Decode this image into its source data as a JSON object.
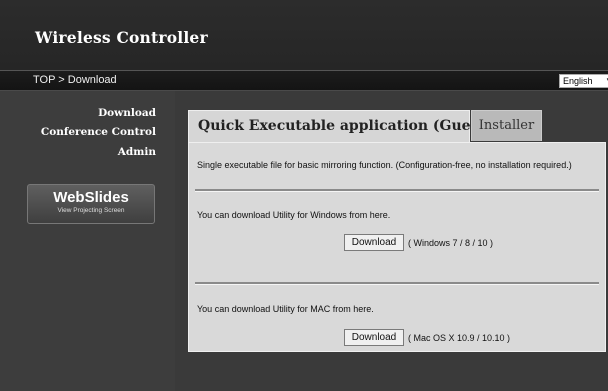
{
  "app": {
    "title": "Wireless Controller"
  },
  "breadcrumb": "TOP > Download",
  "language": {
    "selected": "English"
  },
  "sidebar": {
    "items": [
      {
        "label": "Download"
      },
      {
        "label": "Conference Control"
      },
      {
        "label": "Admin"
      }
    ],
    "webslides": {
      "title": "WebSlides",
      "subtitle": "View Projecting Screen"
    }
  },
  "tabs": [
    {
      "label": "Quick Executable application (Guest)",
      "active": true
    },
    {
      "label": "Installer",
      "active": false
    }
  ],
  "panel": {
    "intro": "Single executable file for basic mirroring function. (Configuration-free, no installation required.)",
    "windows": {
      "text": "You can download Utility for Windows from here.",
      "button": "Download",
      "note": "( Windows 7 / 8 / 10 )"
    },
    "mac": {
      "text": "You can download Utility for MAC from here.",
      "button": "Download",
      "note": "( Mac OS X 10.9 / 10.10 )"
    }
  }
}
